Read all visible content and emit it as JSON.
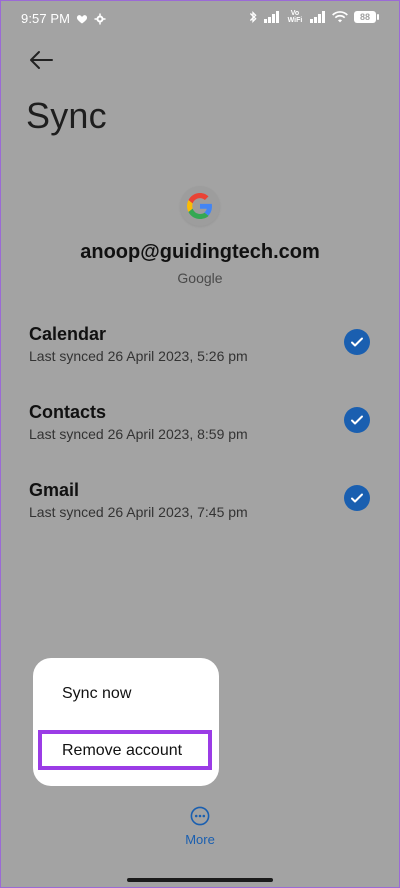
{
  "status_bar": {
    "time": "9:57 PM",
    "vo_wifi_label": "Vo\nWiFi",
    "battery": "88"
  },
  "header": {
    "title": "Sync"
  },
  "account": {
    "email": "anoop@guidingtech.com",
    "provider": "Google"
  },
  "sync_items": [
    {
      "name": "Calendar",
      "status": "Last synced 26 April 2023, 5:26 pm",
      "checked": true
    },
    {
      "name": "Contacts",
      "status": "Last synced 26 April 2023, 8:59 pm",
      "checked": true
    },
    {
      "name": "Gmail",
      "status": "Last synced 26 April 2023, 7:45 pm",
      "checked": true
    }
  ],
  "menu": {
    "items": [
      {
        "label": "Sync now"
      },
      {
        "label": "Remove account",
        "highlighted": true
      }
    ]
  },
  "footer": {
    "more_label": "More"
  },
  "colors": {
    "scrim": "#a3a3a3",
    "accent": "#1a5fb0",
    "highlight": "#9b3ce6",
    "menu_background": "#ffffff"
  },
  "icons": {
    "back": "arrow-left-icon",
    "google": "google-logo-icon",
    "check": "check-circle-icon",
    "more": "more-horizontal-circle-icon"
  }
}
